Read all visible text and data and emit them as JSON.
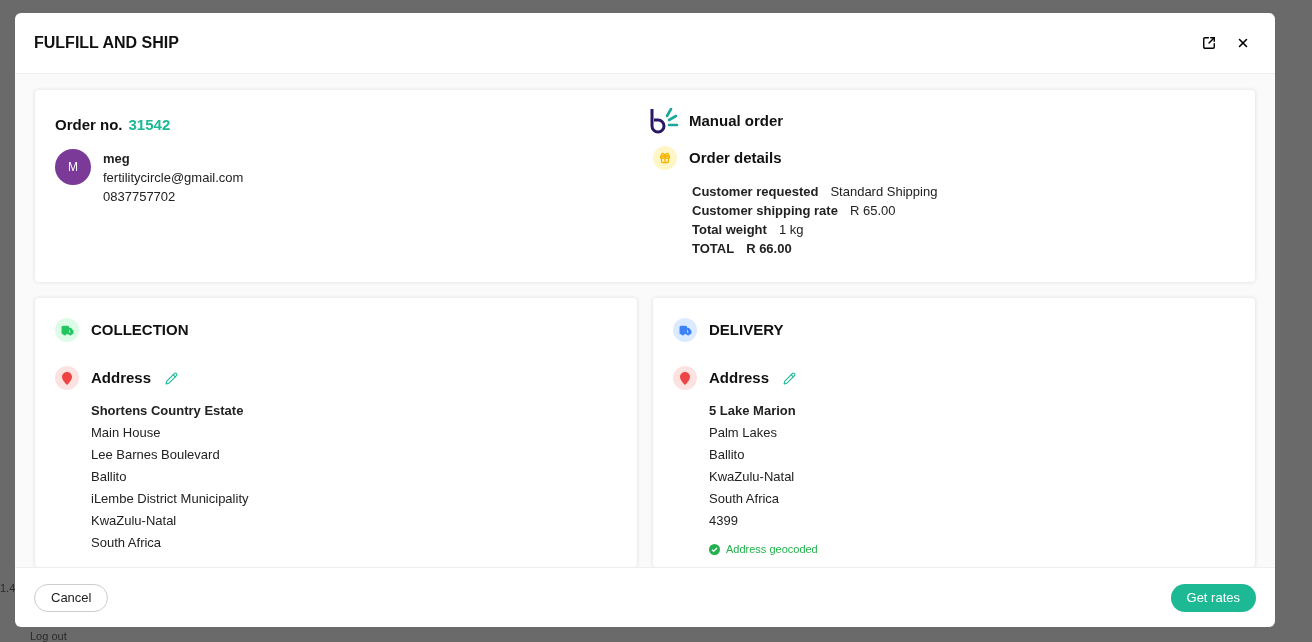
{
  "background": {
    "side_number": "1.4",
    "logout": "Log out"
  },
  "modal": {
    "title": "FULFILL AND SHIP"
  },
  "order": {
    "label": "Order no.",
    "number": "31542",
    "customer": {
      "initial": "M",
      "name": "meg",
      "email": "fertilitycircle@gmail.com",
      "phone": "0837757702"
    },
    "source": "Manual order",
    "details_title": "Order details",
    "details": [
      {
        "kind": "normal",
        "label": "Customer requested",
        "value": "Standard Shipping"
      },
      {
        "kind": "normal",
        "label": "Customer shipping rate",
        "value": "R 65.00"
      },
      {
        "kind": "normal",
        "label": "Total weight",
        "value": "1 kg"
      },
      {
        "kind": "total",
        "label": "TOTAL",
        "value": "R 66.00"
      }
    ]
  },
  "sections": [
    {
      "kind": "collection",
      "title": "COLLECTION",
      "address_label": "Address",
      "address_lines": [
        "Shortens Country Estate",
        "Main House",
        "Lee Barnes Boulevard",
        "Ballito",
        "iLembe District Municipality",
        "KwaZulu-Natal",
        "South Africa"
      ]
    },
    {
      "kind": "delivery",
      "title": "DELIVERY",
      "address_label": "Address",
      "address_lines": [
        "5 Lake Marion",
        "Palm Lakes",
        "Ballito",
        "KwaZulu-Natal",
        "South Africa",
        "4399"
      ],
      "status": "Address geocoded"
    }
  ],
  "footer": {
    "cancel": "Cancel",
    "primary": "Get rates"
  }
}
